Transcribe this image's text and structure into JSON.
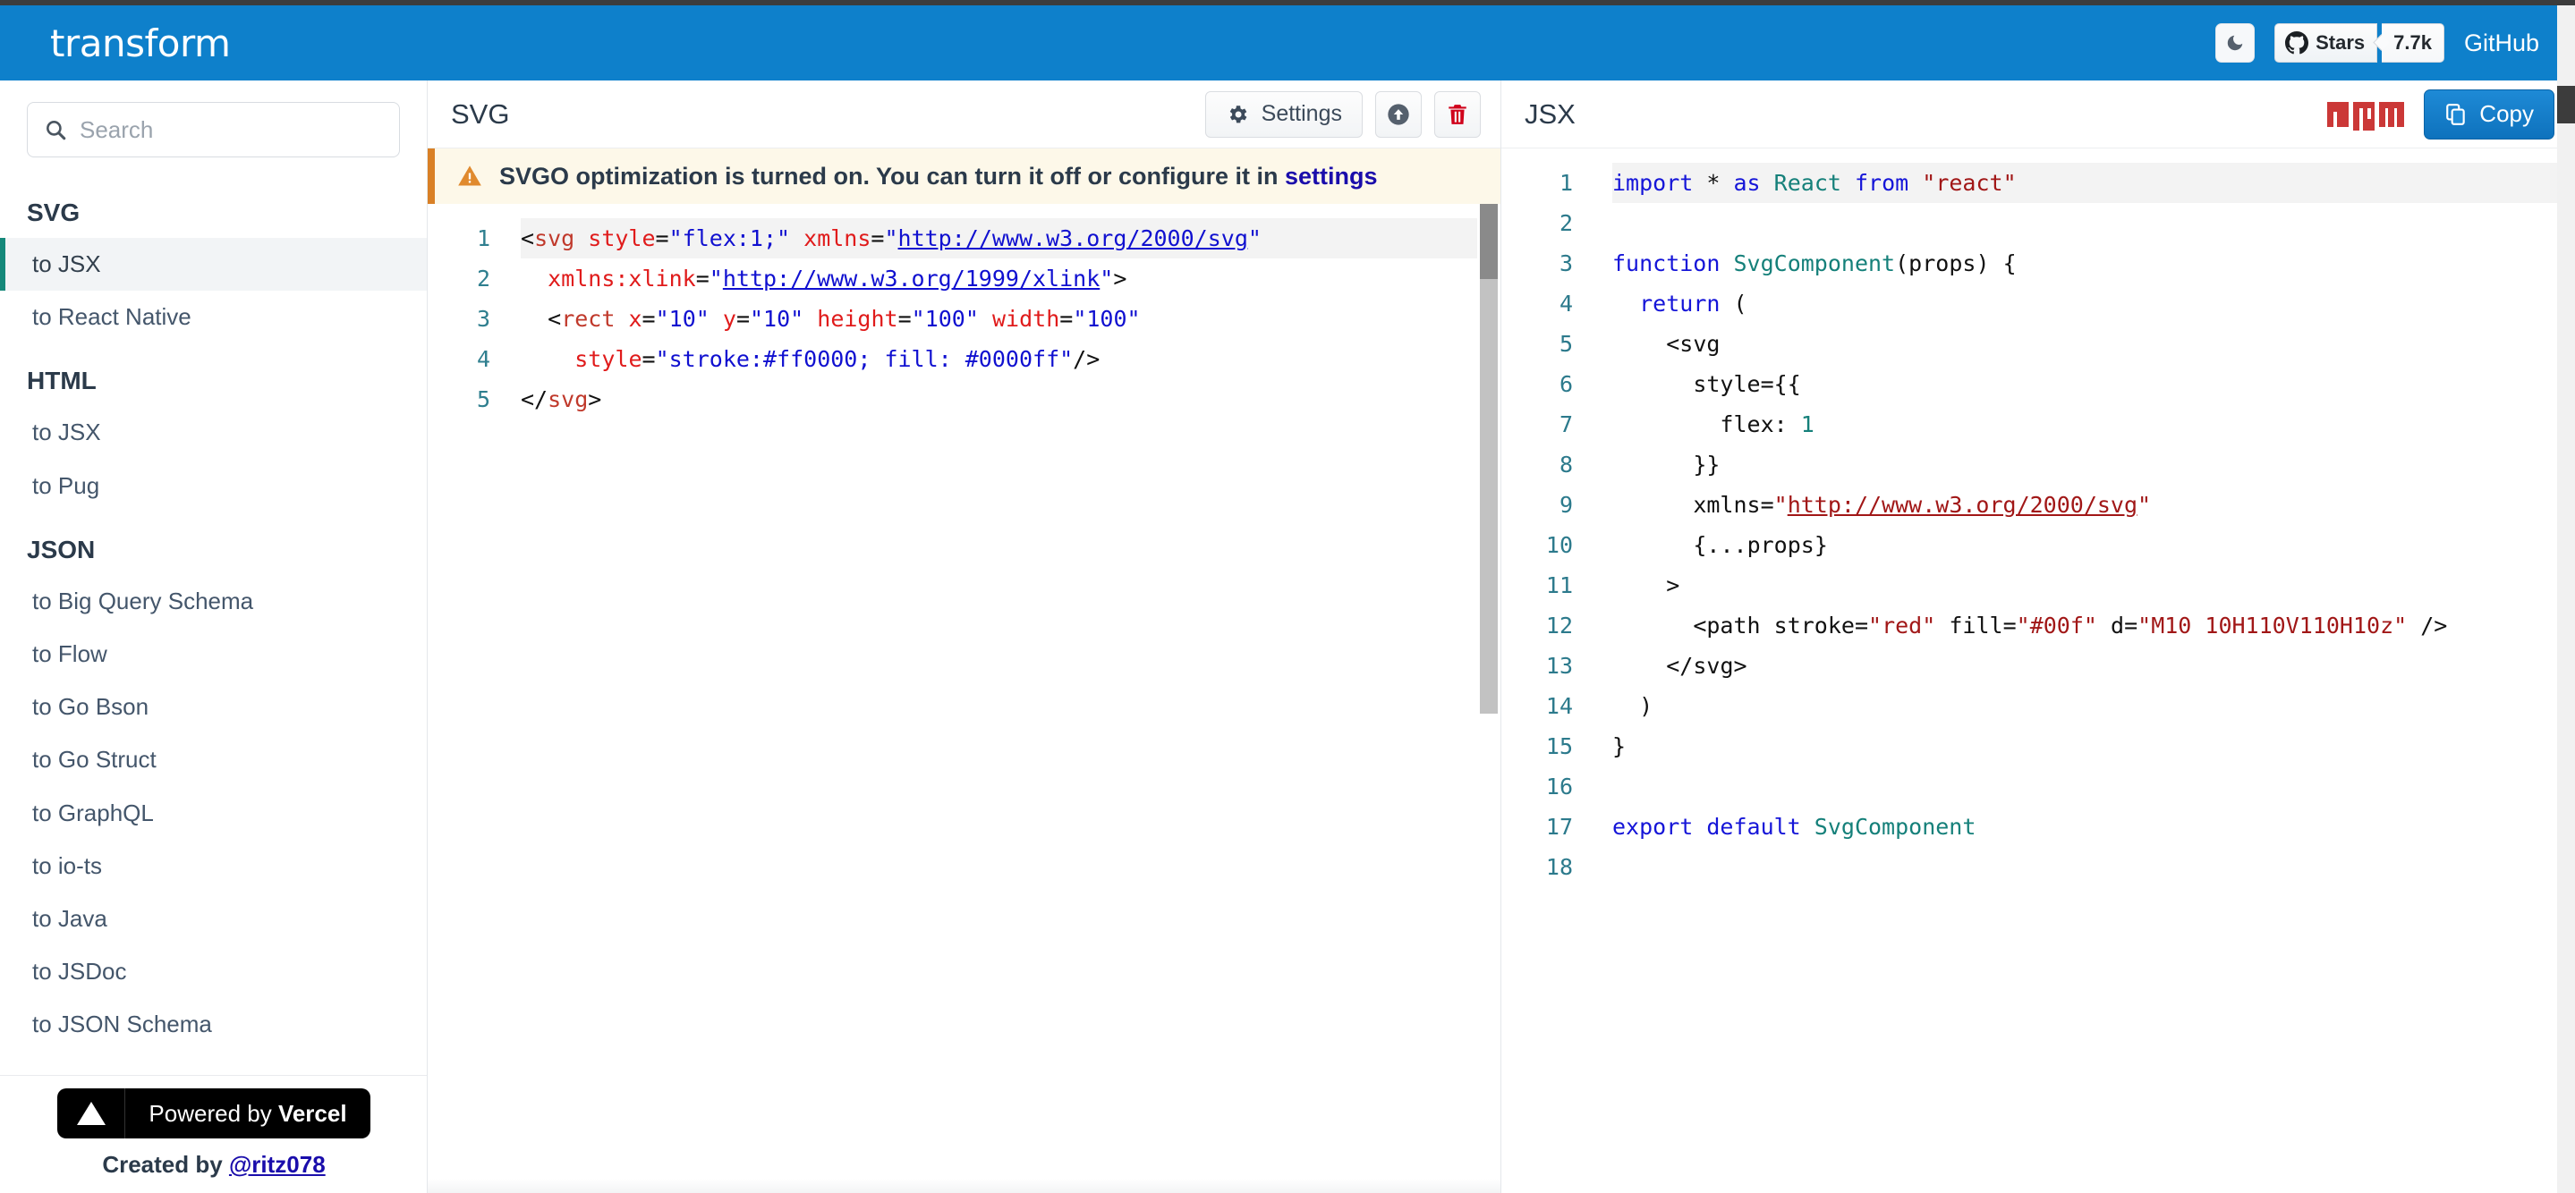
{
  "header": {
    "brand": "transform",
    "theme_toggle_icon": "moon-icon",
    "stars_label": "Stars",
    "stars_count": "7.7k",
    "github_label": "GitHub"
  },
  "sidebar": {
    "search": {
      "value": "",
      "placeholder": "Search",
      "icon": "search-icon"
    },
    "groups": [
      {
        "title": "SVG",
        "items": [
          {
            "label": "to JSX",
            "active": true
          },
          {
            "label": "to React Native",
            "active": false
          }
        ]
      },
      {
        "title": "HTML",
        "items": [
          {
            "label": "to JSX",
            "active": false
          },
          {
            "label": "to Pug",
            "active": false
          }
        ]
      },
      {
        "title": "JSON",
        "items": [
          {
            "label": "to Big Query Schema",
            "active": false
          },
          {
            "label": "to Flow",
            "active": false
          },
          {
            "label": "to Go Bson",
            "active": false
          },
          {
            "label": "to Go Struct",
            "active": false
          },
          {
            "label": "to GraphQL",
            "active": false
          },
          {
            "label": "to io-ts",
            "active": false
          },
          {
            "label": "to Java",
            "active": false
          },
          {
            "label": "to JSDoc",
            "active": false
          },
          {
            "label": "to JSON Schema",
            "active": false
          }
        ]
      }
    ],
    "footer": {
      "vercel_prefix": "Powered by ",
      "vercel_brand": "Vercel",
      "created_prefix": "Created by ",
      "created_handle": "@ritz078"
    }
  },
  "svg_panel": {
    "title": "SVG",
    "settings_label": "Settings",
    "settings_icon": "gear-icon",
    "upload_icon": "arrow-up-circle-icon",
    "delete_icon": "trash-icon",
    "banner": {
      "icon": "warning-triangle-icon",
      "text": "SVGO optimization is turned on. You can turn it off or configure it in ",
      "link": "settings"
    },
    "line_numbers": [
      "1",
      "2",
      "3",
      "4",
      "5"
    ]
  },
  "jsx_panel": {
    "title": "JSX",
    "npm_logo": "npm-logo",
    "copy_label": "Copy",
    "copy_icon": "copy-icon",
    "line_numbers": [
      "1",
      "2",
      "3",
      "4",
      "5",
      "6",
      "7",
      "8",
      "9",
      "10",
      "11",
      "12",
      "13",
      "14",
      "15",
      "16",
      "17",
      "18"
    ]
  },
  "code": {
    "svg_source": "<svg style=\"flex:1;\" xmlns=\"http://www.w3.org/2000/svg\"\n  xmlns:xlink=\"http://www.w3.org/1999/xlink\">\n  <rect x=\"10\" y=\"10\" height=\"100\" width=\"100\"\n    style=\"stroke:#ff0000; fill: #0000ff\"/>\n</svg>",
    "jsx_source": "import * as React from \"react\"\n\nfunction SvgComponent(props) {\n  return (\n    <svg\n      style={{\n        flex: 1\n      }}\n      xmlns=\"http://www.w3.org/2000/svg\"\n      {...props}\n    >\n      <path stroke=\"red\" fill=\"#00f\" d=\"M10 10H110V110H10z\" />\n    </svg>\n  )\n}\n\nexport default SvgComponent\n"
  },
  "colors": {
    "header_blue": "#0e80cb",
    "active_accent": "#15887a",
    "banner_bg": "#fdf8e9",
    "banner_border": "#d98026",
    "npm_red": "#cb3837",
    "copy_blue": "#1e8ad6"
  }
}
